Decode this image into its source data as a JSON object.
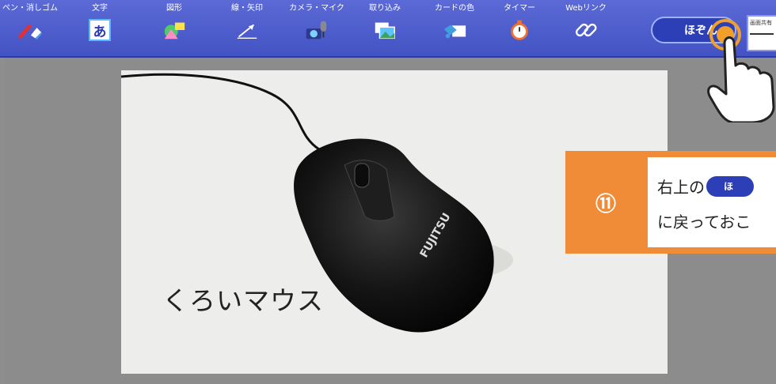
{
  "toolbar": {
    "tools": [
      {
        "label": "ペン・消しゴム",
        "icon": "pen-eraser-icon"
      },
      {
        "label": "文字",
        "icon": "text-icon",
        "glyph": "あ"
      },
      {
        "label": "図形",
        "icon": "shapes-icon"
      },
      {
        "label": "線・矢印",
        "icon": "line-arrow-icon"
      },
      {
        "label": "カメラ・マイク",
        "icon": "camera-mic-icon"
      },
      {
        "label": "取り込み",
        "icon": "import-icon"
      },
      {
        "label": "カードの色",
        "icon": "card-color-icon"
      },
      {
        "label": "タイマー",
        "icon": "timer-icon"
      },
      {
        "label": "Webリンク",
        "icon": "web-link-icon"
      }
    ],
    "save_label": "ほぞん",
    "share_label": "画面共有"
  },
  "card": {
    "caption": "くろいマウス",
    "mouse_brand": "FUJITSU"
  },
  "callout": {
    "number": "⑪",
    "line1_prefix": "右上の",
    "line1_pill": "ほ",
    "line2": "に戻っておこ"
  },
  "colors": {
    "toolbar": "#4b5ac9",
    "accent_orange": "#f08c38",
    "save_button": "#2c3fb7"
  }
}
